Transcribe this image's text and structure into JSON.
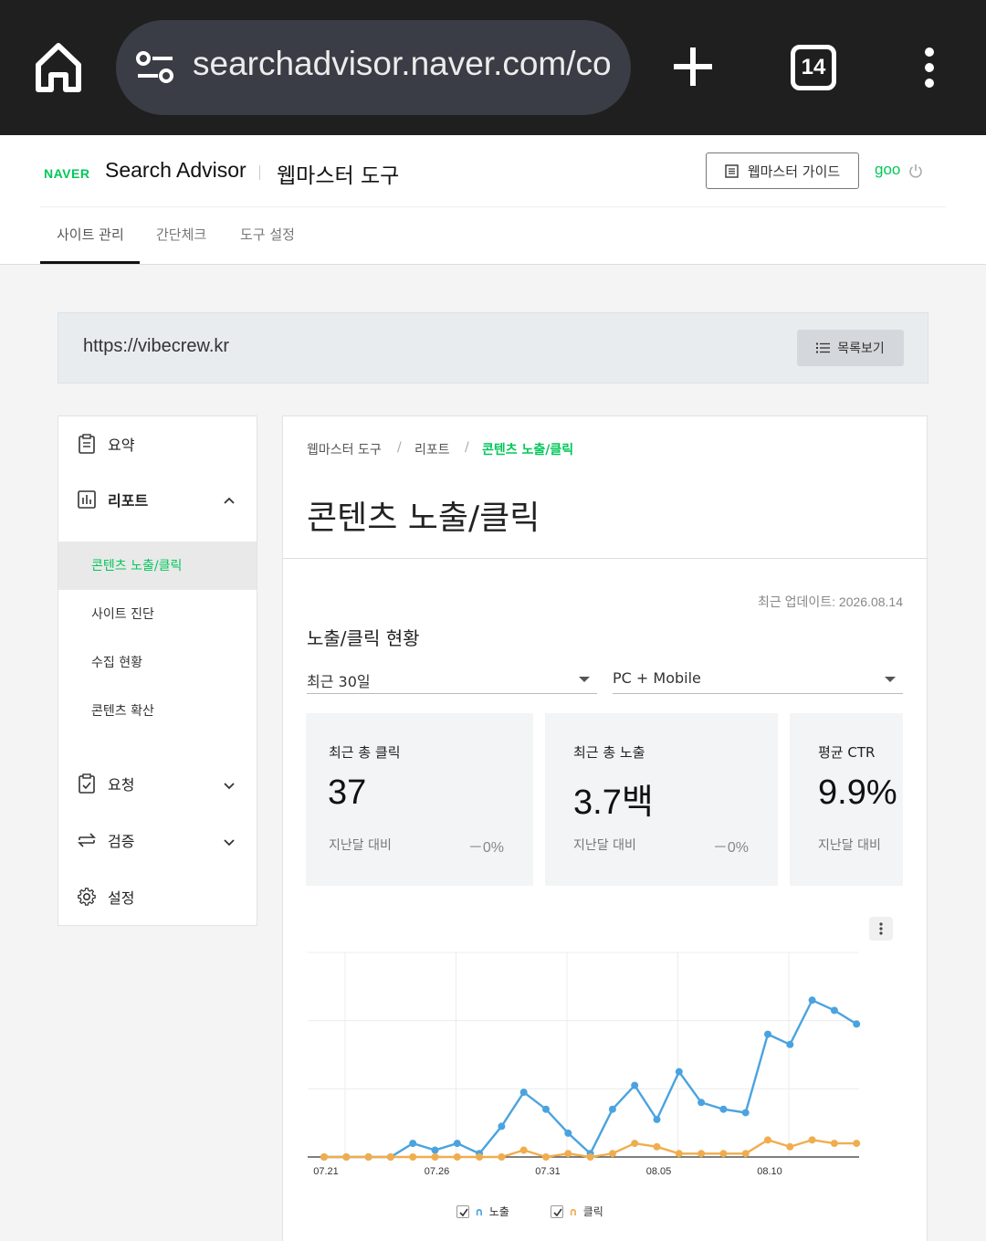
{
  "browser": {
    "url": "searchadvisor.naver.com/co",
    "tab_count": "14"
  },
  "header": {
    "logo_text": "NAVER",
    "brand": "Search Advisor",
    "tool_title": "웹마스터 도구",
    "guide_button": "웹마스터 가이드",
    "user": "goo",
    "tabs": [
      "사이트 관리",
      "간단체크",
      "도구 설정"
    ]
  },
  "site": {
    "url": "https://vibecrew.kr",
    "list_button": "목록보기"
  },
  "sidebar": {
    "summary": "요약",
    "report": "리포트",
    "report_items": [
      "콘텐츠 노출/클릭",
      "사이트 진단",
      "수집 현황",
      "콘텐츠 확산"
    ],
    "request": "요청",
    "verify": "검증",
    "settings": "설정"
  },
  "breadcrumb": {
    "items": [
      "웹마스터 도구",
      "리포트",
      "콘텐츠 노출/클릭"
    ],
    "separator": "/"
  },
  "page": {
    "title": "콘텐츠 노출/클릭",
    "last_update": "최근 업데이트: 2026.08.14",
    "section_title": "노출/클릭 현황",
    "period_select": "최근 30일",
    "device_select": "PC + Mobile"
  },
  "stats": [
    {
      "label": "최근 총 클릭",
      "value": "37",
      "compare": "지난달 대비",
      "delta": "－0%"
    },
    {
      "label": "최근 총 노출",
      "value": "3.7백",
      "compare": "지난달 대비",
      "delta": "－0%"
    },
    {
      "label": "평균 CTR",
      "value": "9.9%",
      "compare": "지난달 대비",
      "delta": ""
    }
  ],
  "colors": {
    "accent": "#03c75a",
    "impressions": "#4aa3df",
    "clicks": "#f0ad4e"
  },
  "chart_data": {
    "type": "line",
    "x_tick_labels": [
      "07.21",
      "07.26",
      "07.31",
      "08.05",
      "08.10"
    ],
    "x": [
      "07.21",
      "07.22",
      "07.23",
      "07.24",
      "07.25",
      "07.26",
      "07.27",
      "07.28",
      "07.29",
      "07.30",
      "07.31",
      "08.01",
      "08.02",
      "08.03",
      "08.04",
      "08.05",
      "08.06",
      "08.07",
      "08.08",
      "08.09",
      "08.10",
      "08.11",
      "08.12",
      "08.13",
      "08.14"
    ],
    "series": [
      {
        "name": "노출",
        "values": [
          0,
          0,
          0,
          0,
          4,
          2,
          4,
          1,
          9,
          19,
          14,
          7,
          1,
          14,
          21,
          11,
          25,
          16,
          14,
          13,
          36,
          33,
          46,
          43,
          39
        ]
      },
      {
        "name": "클릭",
        "values": [
          0,
          0,
          0,
          0,
          0,
          0,
          0,
          0,
          0,
          2,
          0,
          1,
          0,
          1,
          4,
          3,
          1,
          1,
          1,
          1,
          5,
          3,
          5,
          4,
          4
        ]
      }
    ],
    "ylim": [
      0,
      60
    ],
    "grid": true,
    "legend_position": "bottom"
  }
}
